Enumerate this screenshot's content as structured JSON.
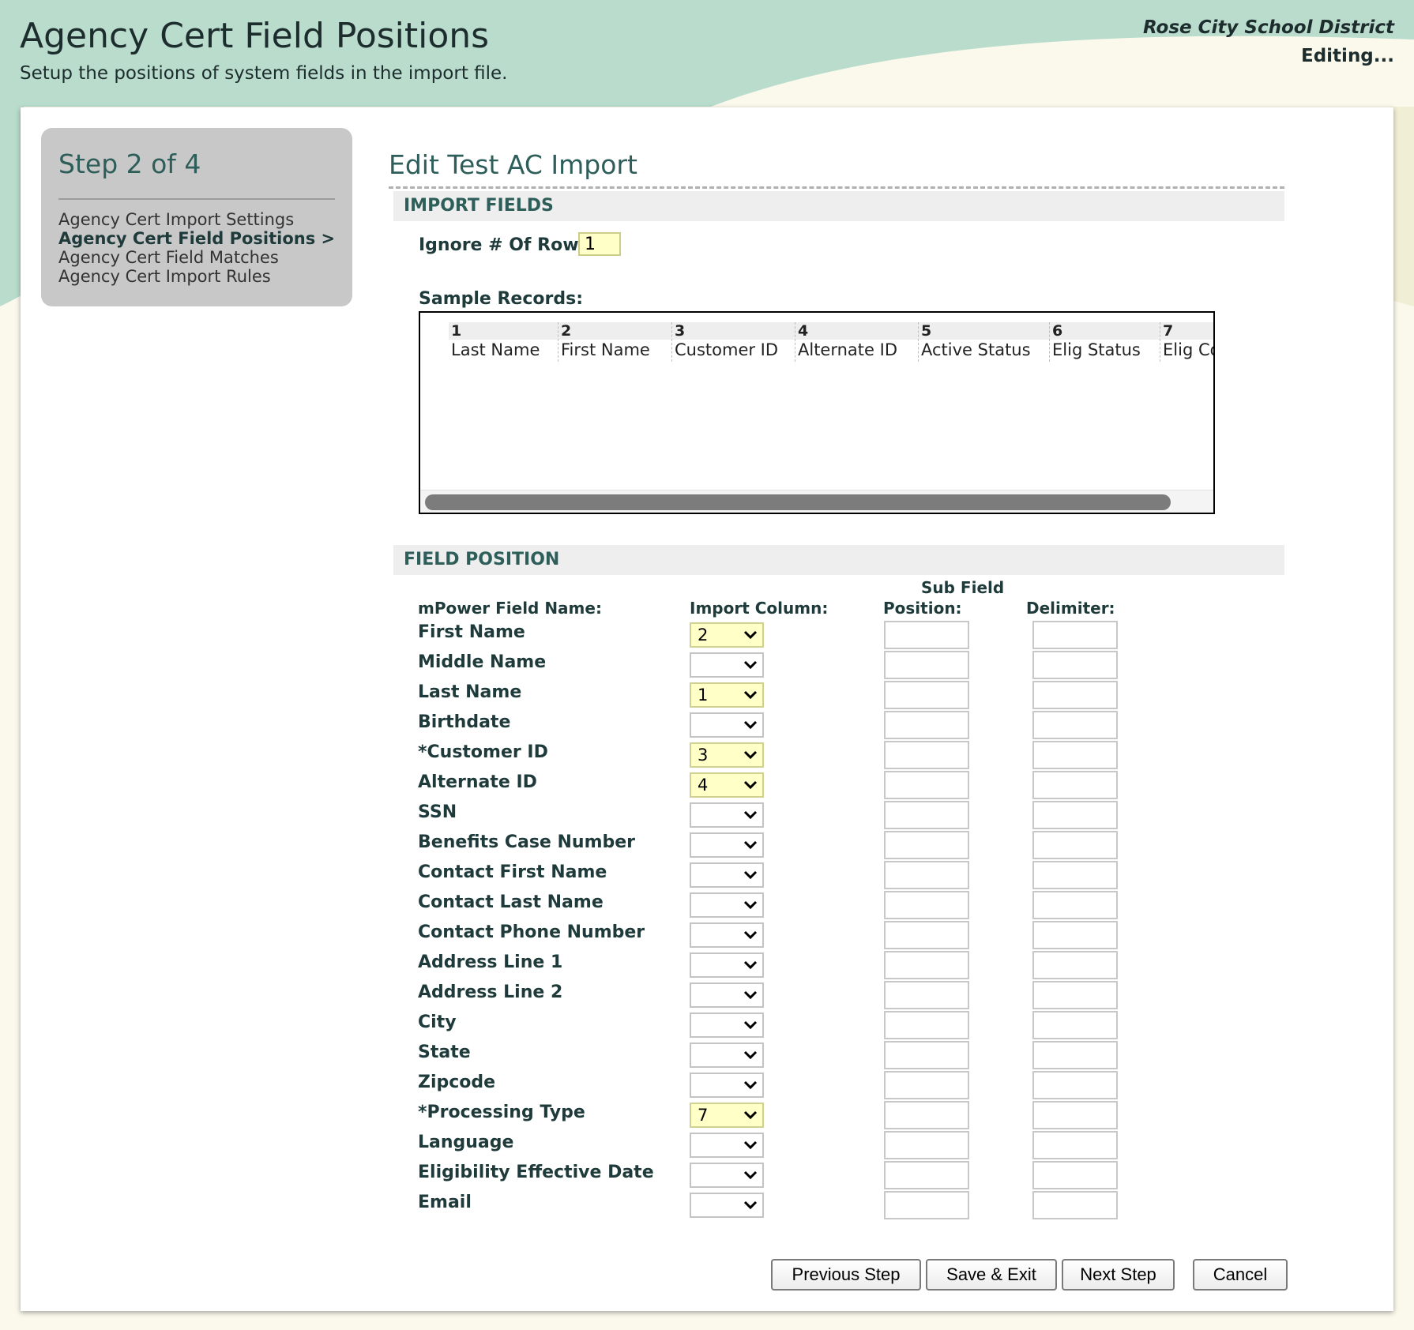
{
  "header": {
    "title": "Agency Cert Field Positions",
    "subtitle": "Setup the positions of system fields in the import file.",
    "district": "Rose City School District",
    "status": "Editing..."
  },
  "steps": {
    "title": "Step 2 of 4",
    "items": [
      {
        "label": "Agency Cert Import Settings",
        "active": false
      },
      {
        "label": "Agency Cert Field Positions >",
        "active": true
      },
      {
        "label": "Agency Cert Field Matches",
        "active": false
      },
      {
        "label": "Agency Cert Import Rules",
        "active": false
      }
    ]
  },
  "form": {
    "title": "Edit Test AC Import",
    "import_section": "IMPORT FIELDS",
    "ignore_label": "Ignore # Of Rows:",
    "ignore_value": "1",
    "sample_label": "Sample Records:",
    "sample_columns": [
      {
        "num": "1",
        "name": "Last Name"
      },
      {
        "num": "2",
        "name": "First Name"
      },
      {
        "num": "3",
        "name": "Customer ID"
      },
      {
        "num": "4",
        "name": "Alternate ID"
      },
      {
        "num": "5",
        "name": "Active Status"
      },
      {
        "num": "6",
        "name": "Elig Status"
      },
      {
        "num": "7",
        "name": "Elig Co"
      }
    ],
    "position_section": "FIELD POSITION",
    "subfield_header": "Sub Field",
    "col_field": "mPower Field Name:",
    "col_import": "Import Column:",
    "col_position": "Position:",
    "col_delimiter": "Delimiter:",
    "fields": [
      {
        "name": "First Name",
        "column": "2"
      },
      {
        "name": "Middle Name",
        "column": ""
      },
      {
        "name": "Last Name",
        "column": "1"
      },
      {
        "name": "Birthdate",
        "column": ""
      },
      {
        "name": "*Customer ID",
        "column": "3"
      },
      {
        "name": "Alternate ID",
        "column": "4"
      },
      {
        "name": "SSN",
        "column": ""
      },
      {
        "name": "Benefits Case Number",
        "column": ""
      },
      {
        "name": "Contact First Name",
        "column": ""
      },
      {
        "name": "Contact Last Name",
        "column": ""
      },
      {
        "name": "Contact Phone Number",
        "column": ""
      },
      {
        "name": "Address Line 1",
        "column": ""
      },
      {
        "name": "Address Line 2",
        "column": ""
      },
      {
        "name": "City",
        "column": ""
      },
      {
        "name": "State",
        "column": ""
      },
      {
        "name": "Zipcode",
        "column": ""
      },
      {
        "name": "*Processing Type",
        "column": "7"
      },
      {
        "name": "Language",
        "column": ""
      },
      {
        "name": "Eligibility Effective Date",
        "column": ""
      },
      {
        "name": "Email",
        "column": ""
      }
    ]
  },
  "buttons": {
    "previous": "Previous Step",
    "save_exit": "Save & Exit",
    "next": "Next Step",
    "cancel": "Cancel"
  },
  "colors": {
    "header_band": "#b9dccd",
    "accent_text": "#2e5e5a",
    "highlight_field": "#ffffc8"
  }
}
